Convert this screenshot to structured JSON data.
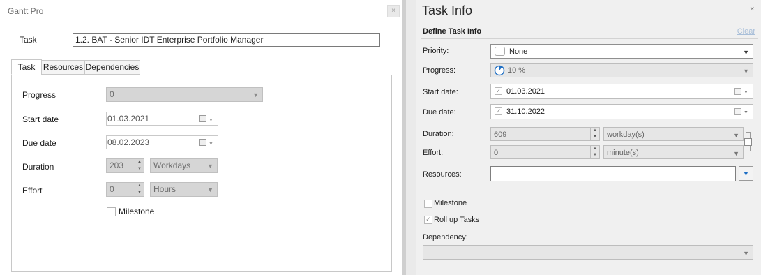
{
  "left_dialog": {
    "title": "Gantt Pro",
    "close_symbol": "×",
    "task_label": "Task",
    "task_value": "1.2. BAT -  Senior IDT Enterprise Portfolio Manager",
    "tabs": [
      "Task",
      "Resources",
      "Dependencies"
    ],
    "active_tab": "Task",
    "progress": {
      "label": "Progress",
      "value": "0"
    },
    "start_date": {
      "label": "Start date",
      "value": "01.03.2021"
    },
    "due_date": {
      "label": "Due date",
      "value": "08.02.2023"
    },
    "duration": {
      "label": "Duration",
      "value": "203",
      "unit": "Workdays"
    },
    "effort": {
      "label": "Effort",
      "value": "0",
      "unit": "Hours"
    },
    "milestone": {
      "label": "Milestone",
      "checked": false
    }
  },
  "task_info": {
    "title": "Task Info",
    "close_symbol": "×",
    "section_title": "Define Task Info",
    "clear_label": "Clear",
    "priority": {
      "label": "Priority:",
      "value": "None"
    },
    "progress": {
      "label": "Progress:",
      "value": "10 %",
      "fraction": 0.1
    },
    "start_date": {
      "label": "Start date:",
      "value": "01.03.2021",
      "checked": true
    },
    "due_date": {
      "label": "Due date:",
      "value": "31.10.2022",
      "checked": true
    },
    "duration": {
      "label": "Duration:",
      "value": "609",
      "unit": "workday(s)"
    },
    "effort": {
      "label": "Effort:",
      "value": "0",
      "unit": "minute(s)"
    },
    "resources": {
      "label": "Resources:",
      "value": ""
    },
    "milestone": {
      "label": "Milestone",
      "checked": false
    },
    "roll_up": {
      "label": "Roll up Tasks",
      "checked": true
    },
    "dependency": {
      "label": "Dependency:",
      "value": ""
    }
  },
  "colors": {
    "accent": "#1f6fc4",
    "disabled_fill": "#d6d6d6",
    "panel_bg": "#f0f0f0",
    "clear_link": "#a9bfd9"
  }
}
